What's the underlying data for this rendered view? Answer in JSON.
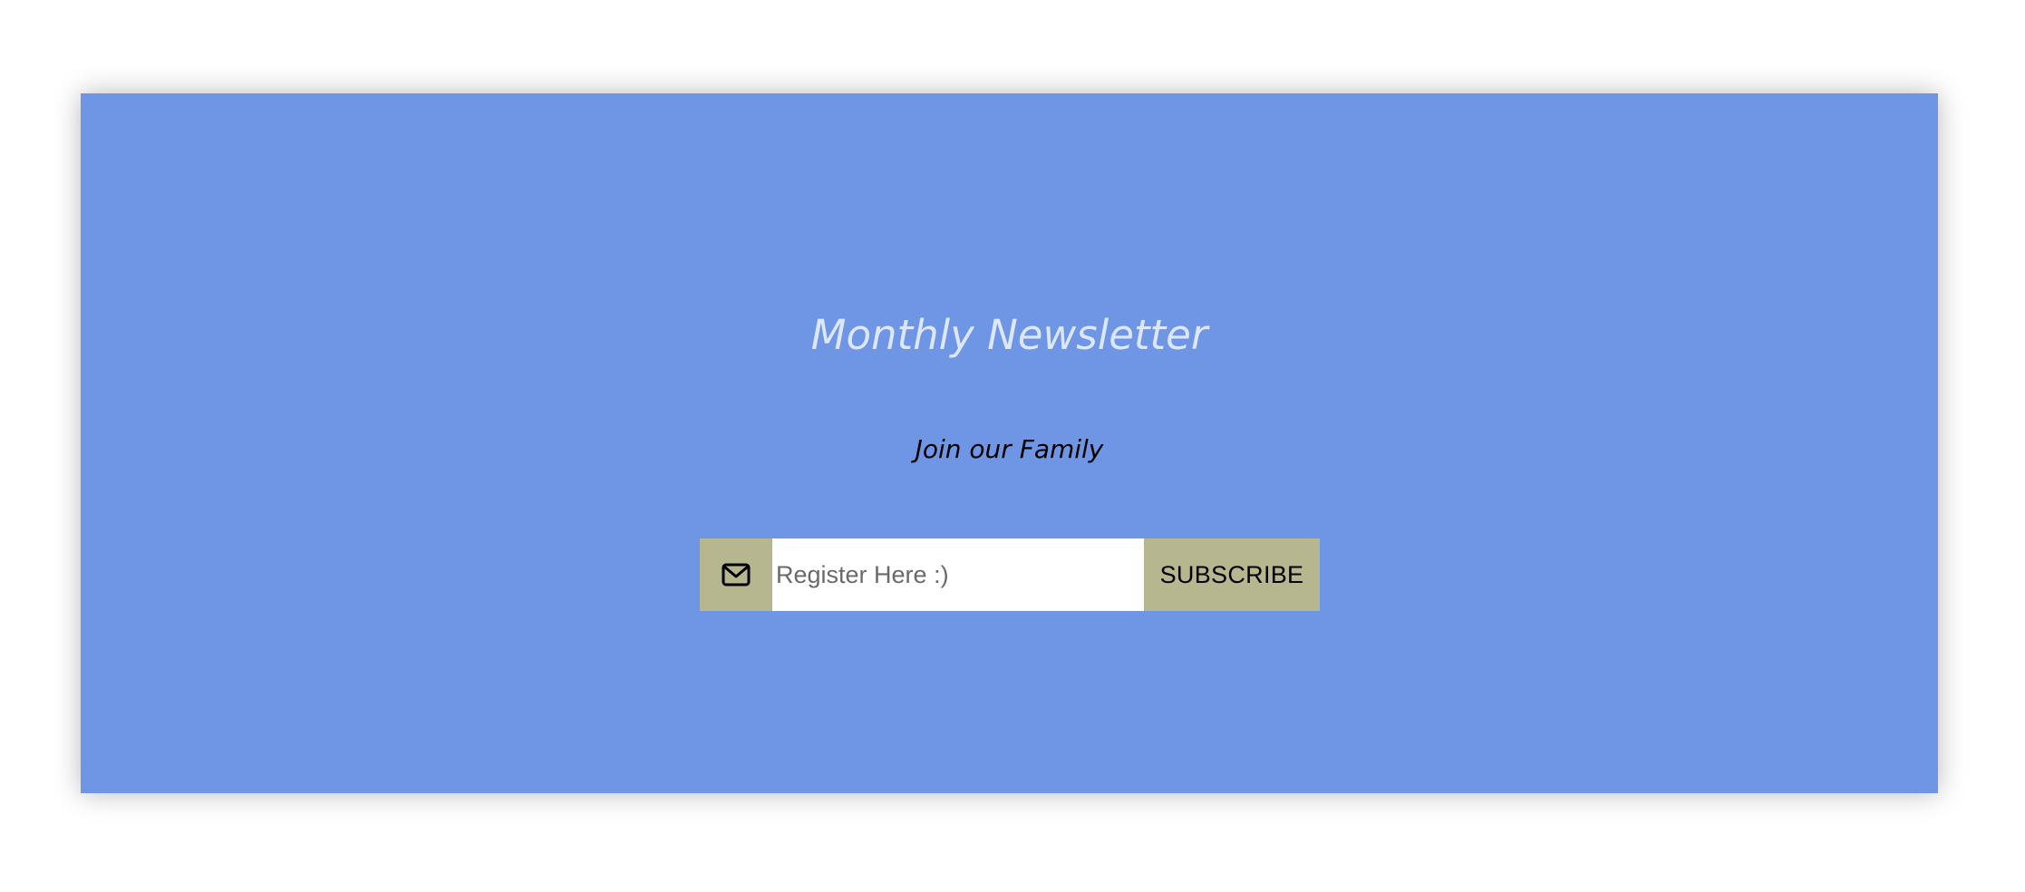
{
  "newsletter": {
    "title": "Monthly Newsletter",
    "subtitle": "Join our Family",
    "email_icon": "envelope-icon",
    "email_placeholder": "Register Here :)",
    "email_value": "",
    "subscribe_label": "SUBSCRIBE"
  },
  "colors": {
    "page_background": "#ffffff",
    "card_background": "#6f95e5",
    "title_text": "#dde7fb",
    "subtitle_text": "#000000",
    "accent_box": "#b6b68f",
    "input_background": "#ffffff"
  }
}
